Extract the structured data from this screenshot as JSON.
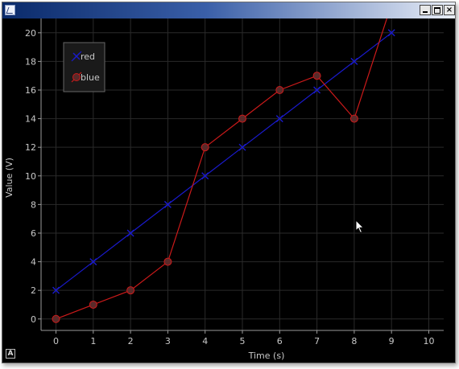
{
  "window": {
    "title": "",
    "close_glyph": "×"
  },
  "badge_label": "A",
  "colors": {
    "background": "#000000",
    "grid": "#2a2a2a",
    "axis": "#9a9a9a",
    "text": "#c8c8c8",
    "red_series": "#1a1acc",
    "blue_series": "#cc1a1a",
    "blue_marker_fill": "#5a2a2a"
  },
  "chart_data": {
    "type": "line",
    "title": "",
    "xlabel": "Time (s)",
    "ylabel": "Value (V)",
    "xlim": [
      -0.4,
      10.4
    ],
    "ylim": [
      -0.8,
      21
    ],
    "xticks": [
      "0",
      "1",
      "2",
      "3",
      "4",
      "5",
      "6",
      "7",
      "8",
      "9",
      "10"
    ],
    "yticks": [
      "0",
      "2",
      "4",
      "6",
      "8",
      "10",
      "12",
      "14",
      "16",
      "18",
      "20"
    ],
    "grid": true,
    "legend_position": "top-left",
    "series": [
      {
        "name": "red",
        "marker": "x",
        "color": "#1a1acc",
        "x": [
          0,
          1,
          2,
          3,
          4,
          5,
          6,
          7,
          8,
          9
        ],
        "y": [
          2,
          4,
          6,
          8,
          10,
          12,
          14,
          16,
          18,
          20
        ]
      },
      {
        "name": "blue",
        "marker": "circle",
        "color": "#cc1a1a",
        "x": [
          0,
          1,
          2,
          3,
          4,
          5,
          6,
          7,
          8,
          9
        ],
        "y": [
          0,
          1,
          2,
          4,
          12,
          14,
          16,
          17,
          14,
          22
        ]
      }
    ]
  }
}
